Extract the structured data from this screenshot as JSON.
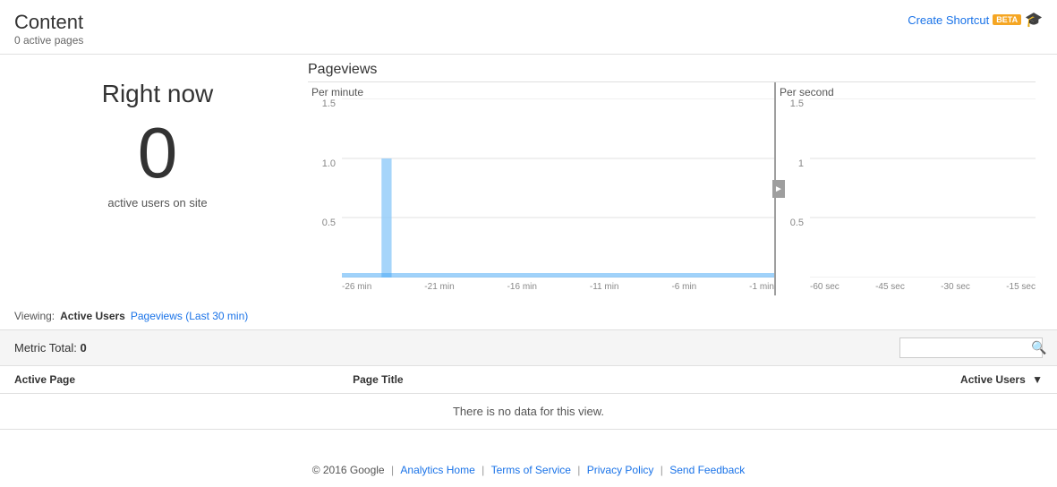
{
  "header": {
    "title": "Content",
    "subtitle": "0 active pages",
    "create_shortcut_label": "Create Shortcut",
    "beta_label": "BETA"
  },
  "right_now": {
    "title": "Right now",
    "count": "0",
    "label": "active users on site"
  },
  "pageviews": {
    "title": "Pageviews",
    "per_minute_label": "Per minute",
    "per_second_label": "Per second",
    "y_labels_left": [
      "1.5",
      "1.0",
      "0.5",
      ""
    ],
    "y_labels_right": [
      "1.5",
      "1",
      "0.5",
      ""
    ],
    "x_labels_left": [
      "-26 min",
      "-21 min",
      "-16 min",
      "-11 min",
      "-6 min",
      "-1 min"
    ],
    "x_labels_right": [
      "-60 sec",
      "-45 sec",
      "-30 sec",
      "-15 sec"
    ]
  },
  "viewing": {
    "prefix": "Viewing:",
    "active_label": "Active Users",
    "pageviews_link": "Pageviews (Last 30 min)"
  },
  "metric": {
    "label": "Metric Total:",
    "value": "0"
  },
  "search": {
    "placeholder": ""
  },
  "table": {
    "columns": [
      "Active Page",
      "Page Title",
      "Active Users"
    ],
    "empty_message": "There is no data for this view."
  },
  "footer": {
    "copyright": "© 2016 Google",
    "links": [
      {
        "label": "Analytics Home",
        "url": "#"
      },
      {
        "label": "Terms of Service",
        "url": "#"
      },
      {
        "label": "Privacy Policy",
        "url": "#"
      },
      {
        "label": "Send Feedback",
        "url": "#"
      }
    ]
  }
}
